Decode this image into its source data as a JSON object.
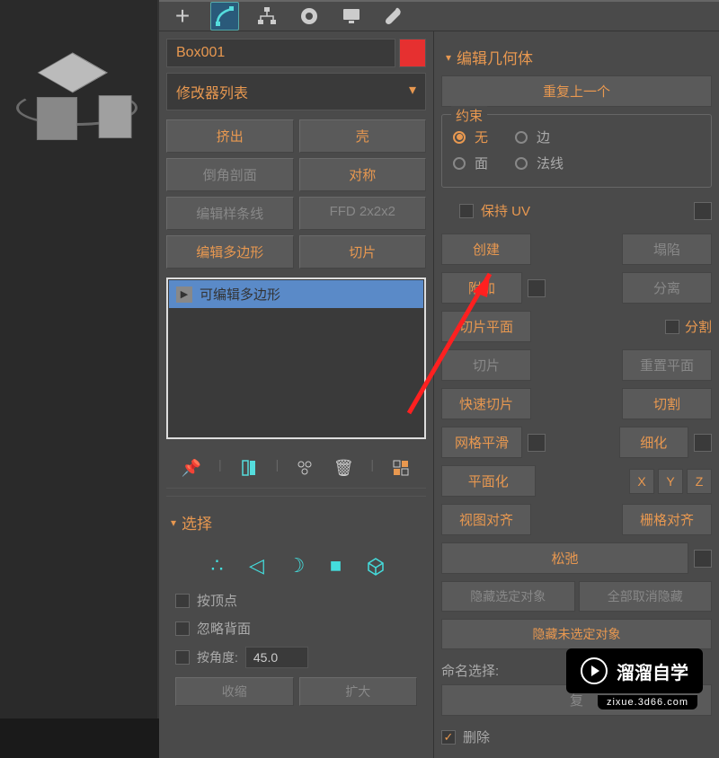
{
  "object_name": "Box001",
  "modifier_dropdown": "修改器列表",
  "modifier_buttons": {
    "extrude": "挤出",
    "shell": "壳",
    "chamfer": "倒角剖面",
    "symmetry": "对称",
    "edit_spline": "编辑样条线",
    "ffd": "FFD 2x2x2",
    "edit_poly": "编辑多边形",
    "slice": "切片"
  },
  "stack_item": "可编辑多边形",
  "selection": {
    "title": "选择",
    "by_vertex": "按顶点",
    "ignore_backface": "忽略背面",
    "by_angle": "按角度:",
    "angle_value": "45.0",
    "shrink": "收缩",
    "grow": "扩大"
  },
  "edit_geometry": {
    "title": "编辑几何体",
    "repeat_last": "重复上一个",
    "constraints": "约束",
    "none": "无",
    "edge": "边",
    "face": "面",
    "normal": "法线",
    "preserve_uv": "保持 UV",
    "create": "创建",
    "collapse": "塌陷",
    "attach": "附加",
    "detach": "分离",
    "slice_plane": "切片平面",
    "split": "分割",
    "slice": "切片",
    "reset_plane": "重置平面",
    "quickslice": "快速切片",
    "cut": "切割",
    "msmooth": "网格平滑",
    "tessellate": "细化",
    "make_planar": "平面化",
    "view_align": "视图对齐",
    "grid_align": "栅格对齐",
    "relax": "松弛",
    "hide_selected": "隐藏选定对象",
    "unhide_all": "全部取消隐藏",
    "hide_unselected": "隐藏未选定对象",
    "named_selections": "命名选择:",
    "copy": "复",
    "delete": "删除"
  },
  "watermark": {
    "text": "溜溜自学",
    "url": "zixue.3d66.com"
  }
}
